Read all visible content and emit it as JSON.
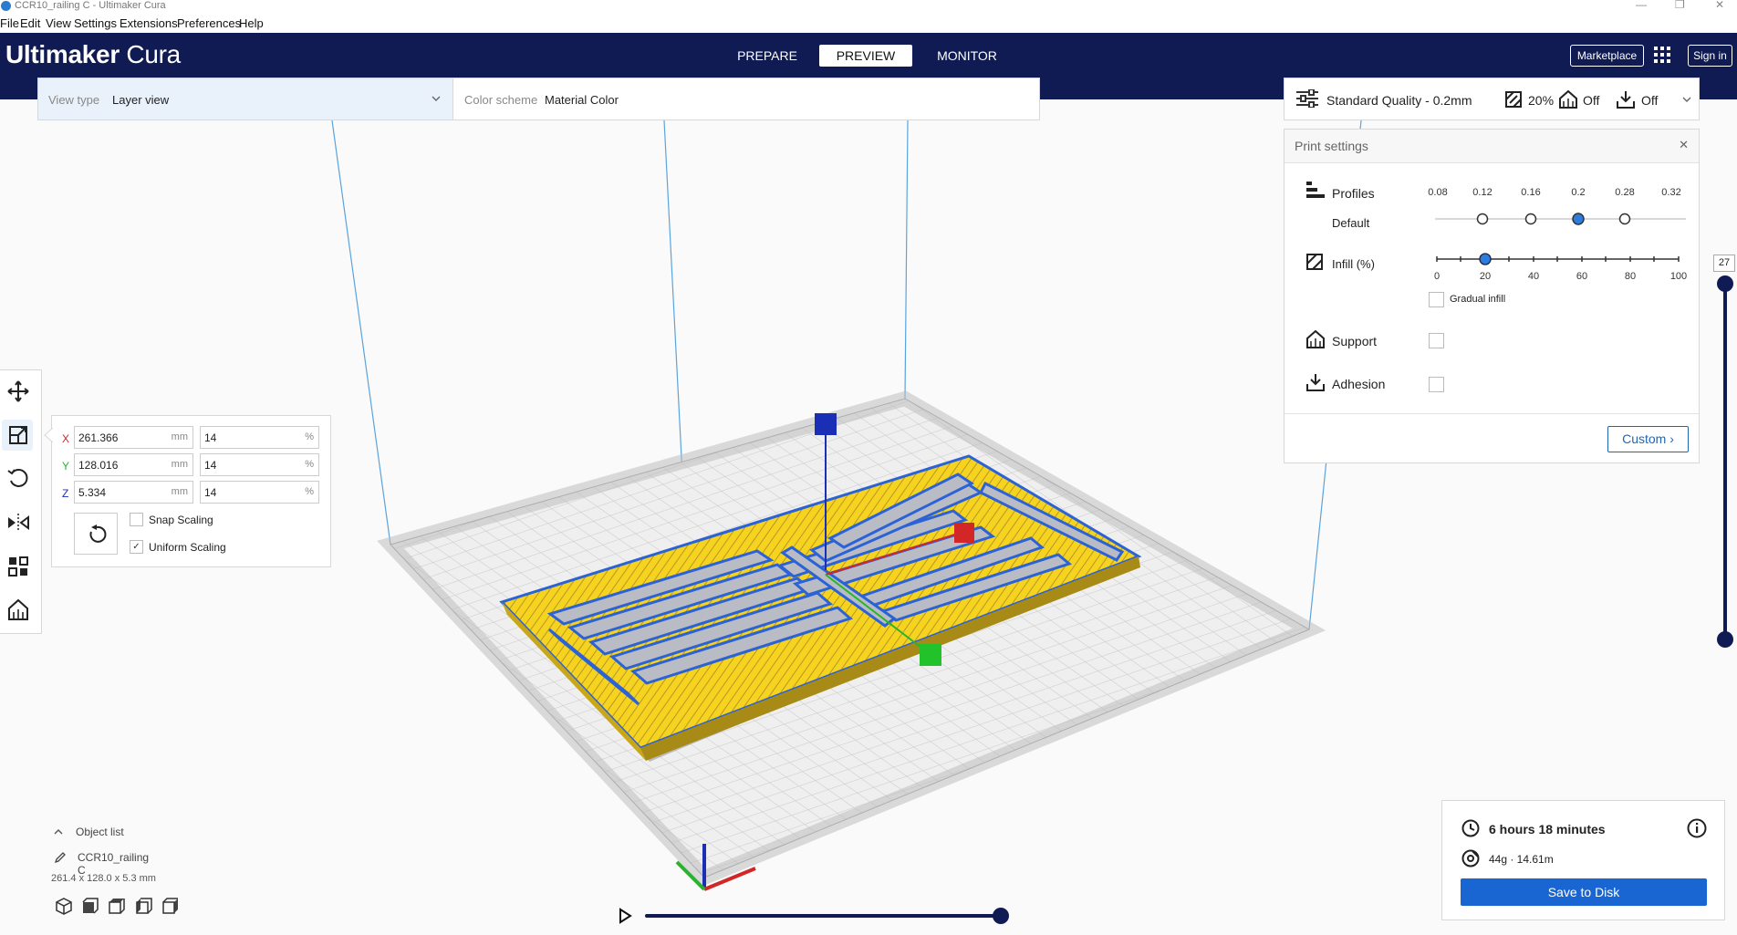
{
  "window": {
    "title": "CCR10_railing C - Ultimaker Cura"
  },
  "menu": [
    "File",
    "Edit",
    "View",
    "Settings",
    "Extensions",
    "Preferences",
    "Help"
  ],
  "header": {
    "brand_bold": "Ultimaker",
    "brand_light": " Cura",
    "stages": [
      "PREPARE",
      "PREVIEW",
      "MONITOR"
    ],
    "active_stage": "PREVIEW",
    "marketplace": "Marketplace",
    "sign_in": "Sign in"
  },
  "viewbar": {
    "view_type_label": "View type",
    "view_type_value": "Layer view",
    "color_scheme_label": "Color scheme",
    "color_scheme_value": "Material Color"
  },
  "settings_bar": {
    "profile": "Standard Quality - 0.2mm",
    "infill": "20%",
    "support": "Off",
    "adhesion": "Off"
  },
  "print_settings": {
    "title": "Print settings",
    "profiles_label": "Profiles",
    "profiles_sub": "Default",
    "layer_heights": [
      "0.08",
      "0.12",
      "0.16",
      "0.2",
      "0.28",
      "0.32"
    ],
    "selected_layer_height": "0.2",
    "infill_label": "Infill (%)",
    "infill_ticks": [
      "0",
      "20",
      "40",
      "60",
      "80",
      "100"
    ],
    "infill_value": 20,
    "gradual_infill": "Gradual infill",
    "support_label": "Support",
    "adhesion_label": "Adhesion",
    "custom_btn": "Custom"
  },
  "scale": {
    "x_label": "X",
    "y_label": "Y",
    "z_label": "Z",
    "x_mm": "261.366",
    "y_mm": "128.016",
    "z_mm": "5.334",
    "x_pct": "14",
    "y_pct": "14",
    "z_pct": "14",
    "mm_unit": "mm",
    "pct_unit": "%",
    "snap_scaling": "Snap Scaling",
    "uniform_scaling": "Uniform Scaling"
  },
  "object_list": {
    "title": "Object list",
    "object_name": "CCR10_railing C",
    "dimensions": "261.4 x 128.0 x 5.3 mm"
  },
  "print_info": {
    "time": "6 hours 18 minutes",
    "material": "44g · 14.61m",
    "save_btn": "Save to Disk"
  },
  "layer_slider": {
    "current_layer": "27"
  },
  "colors": {
    "header": "#0f1b52",
    "accent": "#1966d2",
    "filament": "#f3d21e",
    "wall": "#2b63d6"
  }
}
